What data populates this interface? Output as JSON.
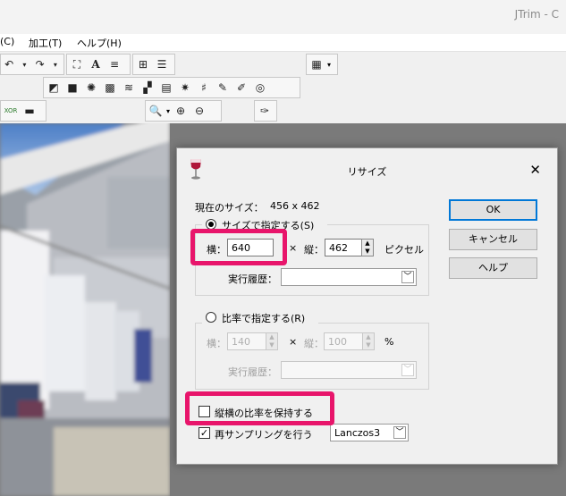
{
  "app": {
    "title": "JTrim - C"
  },
  "menu": [
    {
      "label": "(C)",
      "x": 0
    },
    {
      "label": "加工(T)",
      "x": 32
    },
    {
      "label": "ヘルプ(H)",
      "x": 86
    }
  ],
  "dialog": {
    "title": "リサイズ",
    "close_label": "✕",
    "current_size_label": "現在のサイズ：",
    "current_size_value": "456 x 462",
    "by_size": {
      "label": "サイズで指定する(S)",
      "width_label": "横：",
      "width_value": "640",
      "times": "×",
      "height_label": "縦：",
      "height_value": "462",
      "unit": "ピクセル",
      "history_label": "実行履歴："
    },
    "by_ratio": {
      "label": "比率で指定する(R)",
      "width_label": "横：",
      "width_value": "140",
      "times": "×",
      "height_label": "縦：",
      "height_value": "100",
      "unit": "%",
      "history_label": "実行履歴："
    },
    "keep_ratio_label": "縦横の比率を保持する",
    "keep_ratio_checked": false,
    "resample_label": "再サンプリングを行う",
    "resample_checked": true,
    "resample_method": "Lanczos3",
    "buttons": {
      "ok": "OK",
      "cancel": "キャンセル",
      "help": "ヘルプ"
    }
  },
  "colors": {
    "highlight": "#e8156b",
    "default_button_border": "#0078d7"
  }
}
